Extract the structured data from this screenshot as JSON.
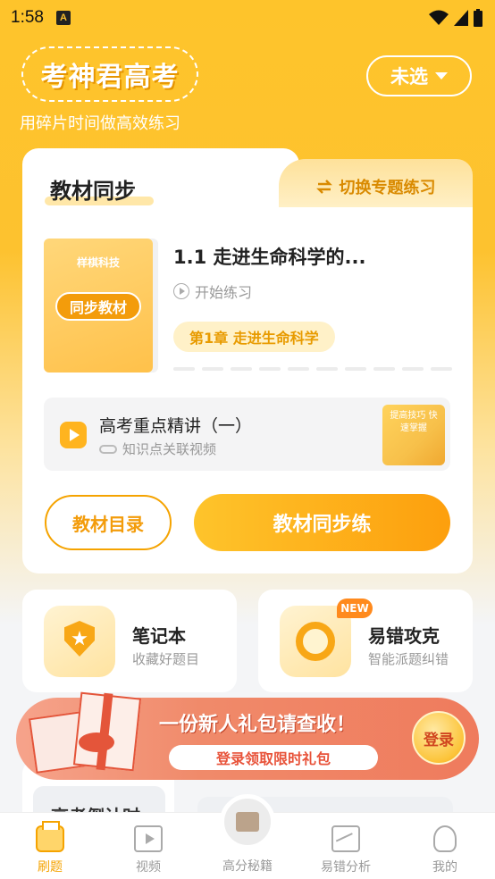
{
  "status_bar": {
    "time": "1:58",
    "notification_icon": "A"
  },
  "header": {
    "logo_text": "考神君高考",
    "slogan": "用碎片时间做高效练习",
    "select_label": "未选"
  },
  "main_card": {
    "tab_title": "教材同步",
    "switch_label": "切换专题练习",
    "book_publisher": "样棋科技",
    "book_tag": "同步教材",
    "lesson_title": "1.1 走进生命科学的...",
    "start_label": "开始练习",
    "chapter_tag": "第1章 走进生命科学",
    "video_title": "高考重点精讲（一）",
    "video_sub": "知识点关联视频",
    "video_thumb_text": "提高技巧 快速掌握",
    "btn_catalog": "教材目录",
    "btn_sync": "教材同步练"
  },
  "features": [
    {
      "title": "笔记本",
      "sub": "收藏好题目",
      "icon": "shield-star-icon"
    },
    {
      "title": "易错攻克",
      "sub": "智能派题纠错",
      "icon": "target-icon",
      "badge": "NEW"
    }
  ],
  "promo": {
    "title": "一份新人礼包请查收！",
    "sub": "登录领取限时礼包",
    "login": "登录"
  },
  "peek": {
    "text": "高考倒计时"
  },
  "bottom_nav": [
    {
      "label": "刷题",
      "icon": "practice-icon",
      "active": true
    },
    {
      "label": "视频",
      "icon": "video-icon"
    },
    {
      "label": "高分秘籍",
      "icon": "book-icon"
    },
    {
      "label": "易错分析",
      "icon": "chart-icon"
    },
    {
      "label": "我的",
      "icon": "user-icon"
    }
  ],
  "colors": {
    "brand": "#fdc22f",
    "accent": "#f5a300",
    "promo": "#ef7b5d"
  }
}
